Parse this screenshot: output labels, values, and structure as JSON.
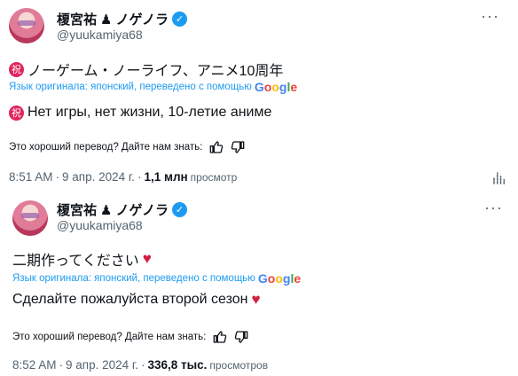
{
  "tweets": [
    {
      "author": "榎宮祐",
      "author_suffix": "ノゲノラ",
      "handle": "@yuukamiya68",
      "original_text": "ノーゲーム・ノーライフ、アニメ10周年",
      "translation_note": "Язык оригинала: японский, переведено с помощью",
      "translated_text": "Нет игры, нет жизни, 10-летие аниме",
      "feedback_prompt": "Это хороший перевод? Дайте нам знать:",
      "time": "8:51 AM",
      "date": "9 апр. 2024 г.",
      "views_count": "1,1 млн",
      "views_label": "просмотр"
    },
    {
      "author": "榎宮祐",
      "author_suffix": "ノゲノラ",
      "handle": "@yuukamiya68",
      "original_text": "二期作ってください",
      "translation_note": "Язык оригинала: японский, переведено с помощью",
      "translated_text": "Сделайте пожалуйста второй сезон",
      "feedback_prompt": "Это хороший перевод? Дайте нам знать:",
      "time": "8:52 AM",
      "date": "9 апр. 2024 г.",
      "views_count": "336,8 тыс.",
      "views_label": "просмотров"
    }
  ],
  "google_logo": [
    "G",
    "o",
    "o",
    "g",
    "l",
    "e"
  ],
  "more_label": "···",
  "colors": {
    "accent": "#1d9bf0",
    "secondary_text": "#536471",
    "heart": "#d11f3f",
    "iwai": "#e0245e"
  },
  "icons": [
    "verified-badge-icon",
    "chess-piece-icon",
    "iwai-icon",
    "heart-icon",
    "thumbs-up-icon",
    "thumbs-down-icon",
    "view-stats-icon",
    "more-icon"
  ]
}
